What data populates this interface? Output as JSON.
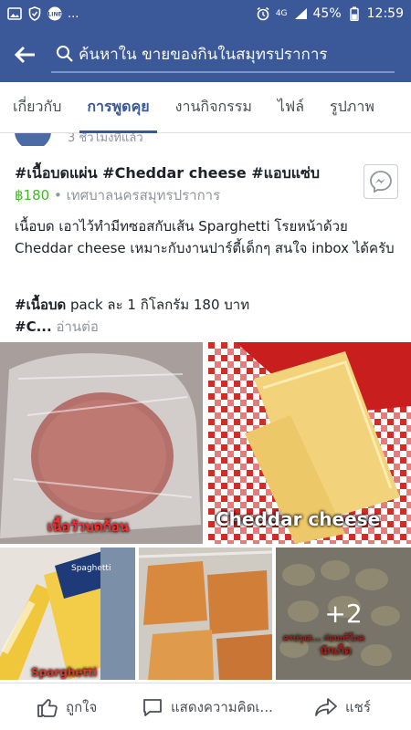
{
  "status_bar": {
    "dots": "...",
    "network": "4G",
    "battery": "45%",
    "time": "12:59"
  },
  "search": {
    "placeholder": "ค้นหาใน ขายของกินในสมุทรปราการ"
  },
  "tabs": [
    {
      "label": "เกี่ยวกับ",
      "active": false
    },
    {
      "label": "การพูดคุย",
      "active": true
    },
    {
      "label": "งานกิจกรรม",
      "active": false
    },
    {
      "label": "ไฟล์",
      "active": false
    },
    {
      "label": "รูปภาพ",
      "active": false
    }
  ],
  "prev_post": {
    "time": "3 ชั่วโมงที่แล้ว"
  },
  "post": {
    "title": "#เนื้อบดแผ่น #Cheddar cheese #แอบแซ่บ",
    "price": "฿180",
    "location": " • เทศบาลนครสมุทรปราการ",
    "description": "เนื้อบด เอาไว้ทำมีทซอสกับเส้น Sparghetti โรยหน้าด้วย Cheddar cheese เหมาะกับงานปาร์ตี้เด็กๆ สนใจ inbox ได้ครับ",
    "tag_bold": "#เนื้อบด",
    "tag_rest": " pack ละ 1 กิโลกรัม 180 บาท",
    "tag2": "#C...",
    "read_more": " อ่านต่อ"
  },
  "photos": {
    "caption_beef": "เนื้อวัวบดก้อน",
    "caption_cheese": "Cheddar cheese",
    "caption_spaghetti": "Sparghetti",
    "caption_nuggets_1": "ครปรุงส... ก่อนบริโภค",
    "caption_nuggets_2": "นักเก็ต",
    "more_count": "+2",
    "spaghetti_brand": "Spaghetti"
  },
  "actions": {
    "like": "ถูกใจ",
    "comment": "แสดงความคิดเ...",
    "share": "แชร์"
  },
  "colors": {
    "brand_blue": "#3b5998",
    "price_green": "#42b72a",
    "muted": "#90949c"
  }
}
